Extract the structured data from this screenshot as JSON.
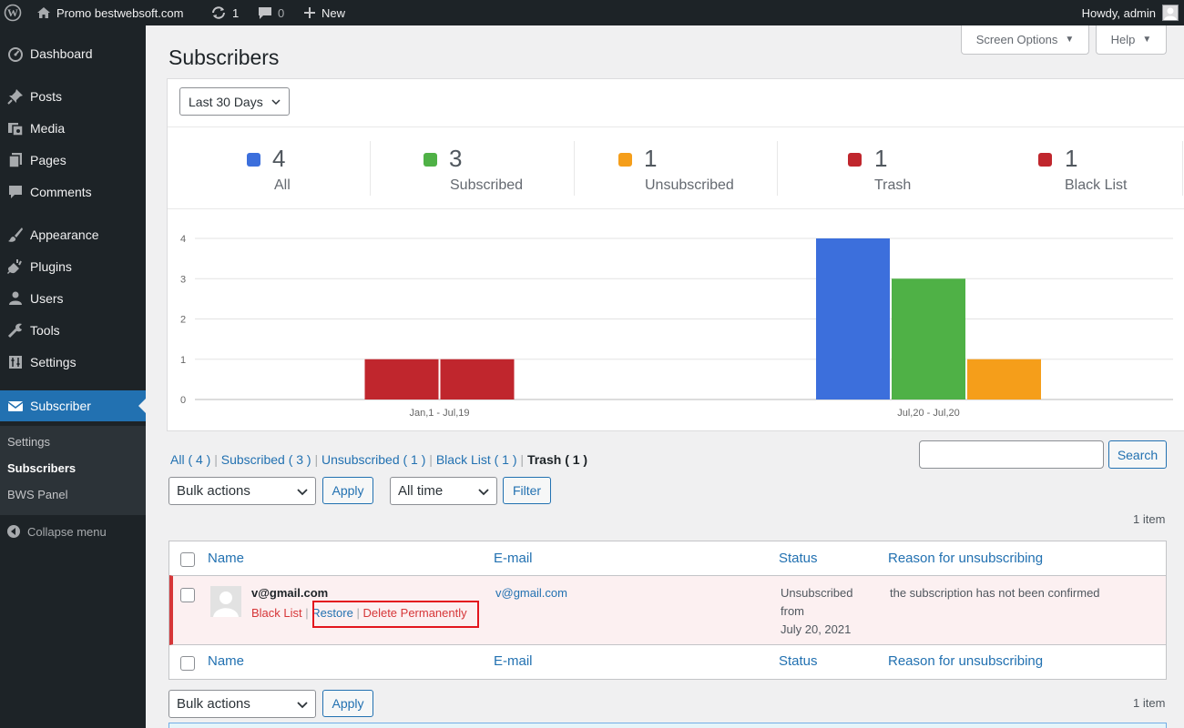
{
  "admin_bar": {
    "site_name": "Promo bestwebsoft.com",
    "updates_count": "1",
    "comments_count": "0",
    "new_label": "New",
    "howdy": "Howdy, admin"
  },
  "sidebar": {
    "items": [
      {
        "label": "Dashboard",
        "icon": "dashboard-icon"
      },
      {
        "label": "Posts",
        "icon": "pushpin-icon"
      },
      {
        "label": "Media",
        "icon": "media-icon"
      },
      {
        "label": "Pages",
        "icon": "page-icon"
      },
      {
        "label": "Comments",
        "icon": "comment-icon"
      },
      {
        "label": "Appearance",
        "icon": "brush-icon"
      },
      {
        "label": "Plugins",
        "icon": "plug-icon"
      },
      {
        "label": "Users",
        "icon": "user-icon"
      },
      {
        "label": "Tools",
        "icon": "wrench-icon"
      },
      {
        "label": "Settings",
        "icon": "settings-icon"
      },
      {
        "label": "Subscriber",
        "icon": "envelope-icon"
      }
    ],
    "submenu": [
      "Settings",
      "Subscribers",
      "BWS Panel"
    ],
    "collapse_label": "Collapse menu"
  },
  "screen_options_label": "Screen Options",
  "help_label": "Help",
  "page_title": "Subscribers",
  "period_select": "Last 30 Days",
  "stats": [
    {
      "value": "4",
      "label": "All",
      "color": "#3c6fdc"
    },
    {
      "value": "3",
      "label": "Subscribed",
      "color": "#4fb146"
    },
    {
      "value": "1",
      "label": "Unsubscribed",
      "color": "#f59e1a"
    },
    {
      "value": "1",
      "label": "Trash",
      "color": "#c0262d"
    },
    {
      "value": "1",
      "label": "Black List",
      "color": "#c0262d"
    }
  ],
  "chart_data": {
    "type": "bar",
    "categories": [
      "Jan,1 - Jul,19",
      "Jul,20 - Jul,20"
    ],
    "series": [
      {
        "values": [
          0,
          4
        ],
        "color": "#3c6fdc"
      },
      {
        "values": [
          0,
          3
        ],
        "color": "#4fb146"
      },
      {
        "values": [
          0,
          1
        ],
        "color": "#f59e1a"
      },
      {
        "values": [
          1,
          0
        ],
        "color": "#c0262d"
      },
      {
        "values": [
          1,
          0
        ],
        "color": "#c0262d"
      }
    ],
    "yticks": [
      "0",
      "1",
      "2",
      "3",
      "4"
    ],
    "ylim": [
      0,
      4
    ],
    "grid": true
  },
  "views": {
    "all": "All ( 4 )",
    "subscribed": "Subscribed ( 3 )",
    "unsubscribed": "Unsubscribed ( 1 )",
    "blacklist": "Black List ( 1 )",
    "trash": "Trash ( 1 )",
    "separator": "|"
  },
  "search_button": "Search",
  "bulk_actions": "Bulk actions",
  "apply_label": "Apply",
  "time_filter": "All time",
  "filter_label": "Filter",
  "items_count": "1 item",
  "table": {
    "col_name": "Name",
    "col_email": "E-mail",
    "col_status": "Status",
    "col_reason": "Reason for unsubscribing",
    "row": {
      "name": "v@gmail.com",
      "email": "v@gmail.com",
      "status_line1": "Unsubscribed",
      "status_line2": "from",
      "status_line3": "July 20, 2021",
      "reason": "the subscription has not been confirmed",
      "action_blacklist": "Black List",
      "action_restore": "Restore",
      "action_delete": "Delete Permanently",
      "action_sep": "|"
    }
  }
}
